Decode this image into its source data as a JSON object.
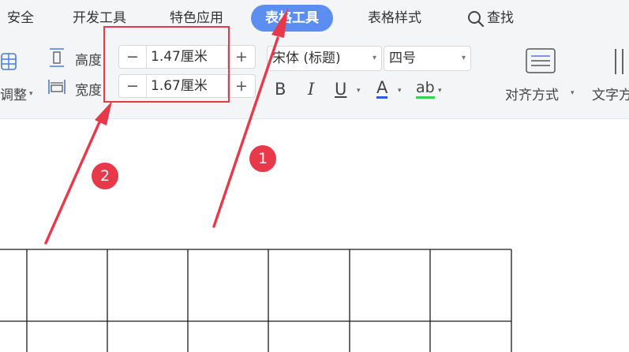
{
  "tabs": [
    {
      "label": "安全"
    },
    {
      "label": "开发工具"
    },
    {
      "label": "特色应用"
    },
    {
      "label": "表格工具"
    },
    {
      "label": "表格样式"
    }
  ],
  "active_tab": "表格工具",
  "search": {
    "label": "查找"
  },
  "toolbar": {
    "adjust_label": "调整",
    "height_label": "高度:",
    "height_value": "1.47厘米",
    "width_label": "宽度:",
    "width_value": "1.67厘米",
    "minus": "−",
    "plus": "+",
    "font_name": "宋体 (标题)",
    "font_size": "四号",
    "bold": "B",
    "italic": "I",
    "underline": "U",
    "font_color": "A",
    "highlight": "ab",
    "align_label": "对齐方式",
    "text_dir_label": "文字方"
  },
  "annotations": {
    "badge_1": "1",
    "badge_2": "2"
  },
  "colors": {
    "accent_tab": "#5b8ef0",
    "annotation_red": "#e8394a",
    "font_color_underline": "#2b5fd9",
    "highlight_underline": "#35d44a"
  }
}
